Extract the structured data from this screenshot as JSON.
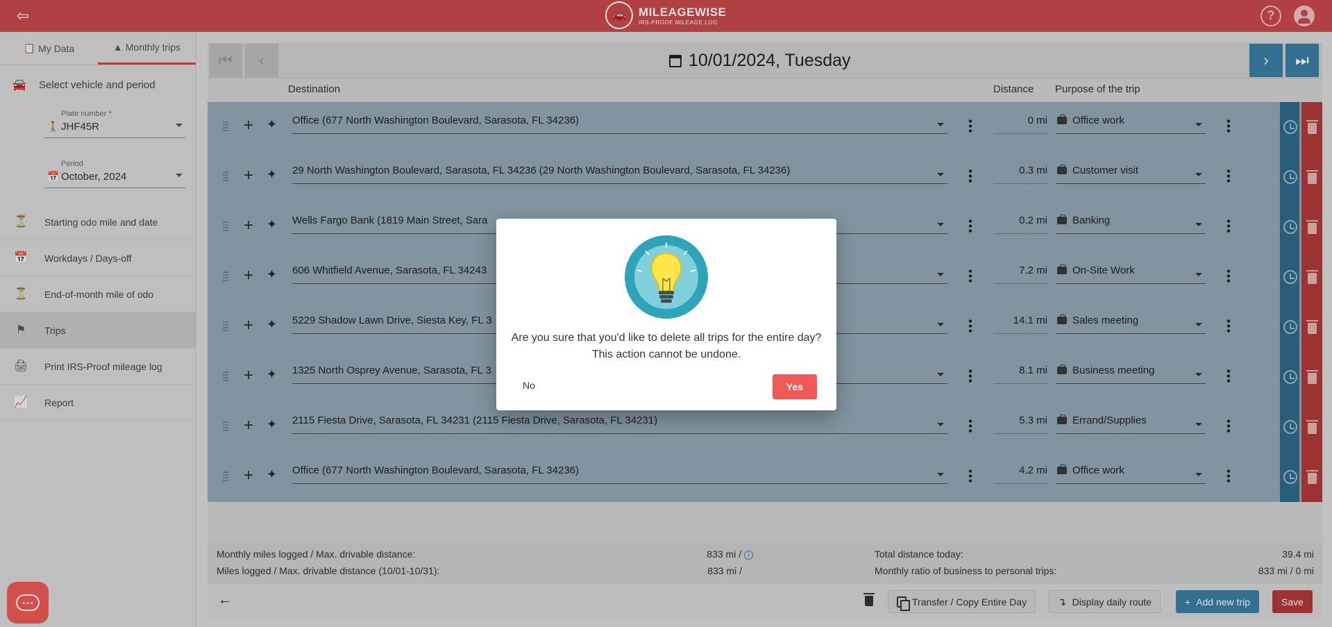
{
  "app": {
    "logo_title": "MILEAGEWISE",
    "logo_subtitle": "IRS-PROOF MILEAGE LOG",
    "brand_color": "#c9494a"
  },
  "sidebar": {
    "tabs": [
      {
        "label": "My Data",
        "icon": "clipboard-icon"
      },
      {
        "label": "Monthly trips",
        "icon": "road-icon"
      }
    ],
    "select_title": "Select vehicle and period",
    "plate_label": "Plate number *",
    "plate_value": "JHF45R",
    "period_label": "Period",
    "period_value": "October, 2024",
    "items": [
      {
        "label": "Starting odo mile and date",
        "icon": "odometer-icon"
      },
      {
        "label": "Workdays / Days-off",
        "icon": "calendar-icon"
      },
      {
        "label": "End-of-month mile of odo",
        "icon": "odometer-icon"
      },
      {
        "label": "Trips",
        "icon": "flag-icon"
      },
      {
        "label": "Print IRS-Proof mileage log",
        "icon": "printer-icon"
      },
      {
        "label": "Report",
        "icon": "chart-icon"
      }
    ]
  },
  "main": {
    "date_title": "10/01/2024, Tuesday",
    "columns": {
      "destination": "Destination",
      "distance": "Distance",
      "purpose": "Purpose of the trip"
    },
    "trips": [
      {
        "destination": "Office (677 North Washington Boulevard, Sarasota, FL 34236)",
        "distance": "0 mi",
        "purpose": "Office work"
      },
      {
        "destination": "29 North Washington Boulevard, Sarasota, FL 34236 (29 North Washington Boulevard, Sarasota, FL 34236)",
        "distance": "0.3 mi",
        "purpose": "Customer visit"
      },
      {
        "destination": "Wells Fargo Bank (1819 Main Street, Sara",
        "distance": "0.2 mi",
        "purpose": "Banking"
      },
      {
        "destination": "606 Whitfield Avenue, Sarasota, FL 34243",
        "distance": "7.2 mi",
        "purpose": "On-Site Work"
      },
      {
        "destination": "5229 Shadow Lawn Drive, Siesta Key, FL 3",
        "distance": "14.1 mi",
        "purpose": "Sales meeting"
      },
      {
        "destination": "1325 North Osprey Avenue, Sarasota, FL 3",
        "distance": "8.1 mi",
        "purpose": "Business meeting"
      },
      {
        "destination": "2115 Fiesta Drive, Sarasota, FL 34231 (2115 Fiesta Drive, Sarasota, FL 34231)",
        "distance": "5.3 mi",
        "purpose": "Errand/Supplies"
      },
      {
        "destination": "Office (677 North Washington Boulevard, Sarasota, FL 34236)",
        "distance": "4.2 mi",
        "purpose": "Office work"
      }
    ],
    "summary": {
      "monthly_label": "Monthly miles logged / Max. drivable distance:",
      "monthly_value": "833 mi /",
      "logged_label": "Miles logged / Max. drivable distance (10/01-10/31):",
      "logged_value": "833 mi /",
      "total_label": "Total distance today:",
      "total_value": "39.4 mi",
      "ratio_label": "Monthly ratio of business to personal trips:",
      "ratio_value": "833 mi / 0 mi"
    },
    "toolbar": {
      "transfer_label": "Transfer / Copy Entire Day",
      "route_label": "Display daily route",
      "add_label": "Add new trip",
      "save_label": "Save"
    }
  },
  "dialog": {
    "line1": "Are you sure that you'd like to delete all trips for the entire day?",
    "line2": "This action cannot be undone.",
    "no_label": "No",
    "yes_label": "Yes",
    "accent": "#f05a56"
  }
}
